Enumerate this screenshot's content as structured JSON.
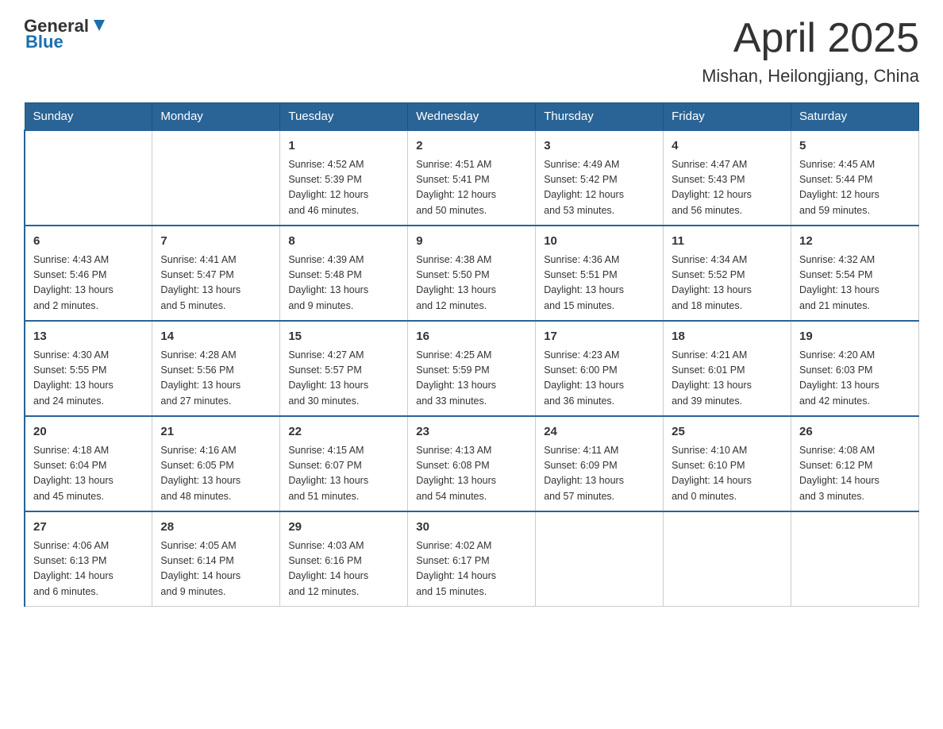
{
  "header": {
    "logo": {
      "general": "General",
      "blue": "Blue"
    },
    "title": "April 2025",
    "location": "Mishan, Heilongjiang, China"
  },
  "calendar": {
    "days_of_week": [
      "Sunday",
      "Monday",
      "Tuesday",
      "Wednesday",
      "Thursday",
      "Friday",
      "Saturday"
    ],
    "weeks": [
      [
        {
          "day": "",
          "info": ""
        },
        {
          "day": "",
          "info": ""
        },
        {
          "day": "1",
          "info": "Sunrise: 4:52 AM\nSunset: 5:39 PM\nDaylight: 12 hours\nand 46 minutes."
        },
        {
          "day": "2",
          "info": "Sunrise: 4:51 AM\nSunset: 5:41 PM\nDaylight: 12 hours\nand 50 minutes."
        },
        {
          "day": "3",
          "info": "Sunrise: 4:49 AM\nSunset: 5:42 PM\nDaylight: 12 hours\nand 53 minutes."
        },
        {
          "day": "4",
          "info": "Sunrise: 4:47 AM\nSunset: 5:43 PM\nDaylight: 12 hours\nand 56 minutes."
        },
        {
          "day": "5",
          "info": "Sunrise: 4:45 AM\nSunset: 5:44 PM\nDaylight: 12 hours\nand 59 minutes."
        }
      ],
      [
        {
          "day": "6",
          "info": "Sunrise: 4:43 AM\nSunset: 5:46 PM\nDaylight: 13 hours\nand 2 minutes."
        },
        {
          "day": "7",
          "info": "Sunrise: 4:41 AM\nSunset: 5:47 PM\nDaylight: 13 hours\nand 5 minutes."
        },
        {
          "day": "8",
          "info": "Sunrise: 4:39 AM\nSunset: 5:48 PM\nDaylight: 13 hours\nand 9 minutes."
        },
        {
          "day": "9",
          "info": "Sunrise: 4:38 AM\nSunset: 5:50 PM\nDaylight: 13 hours\nand 12 minutes."
        },
        {
          "day": "10",
          "info": "Sunrise: 4:36 AM\nSunset: 5:51 PM\nDaylight: 13 hours\nand 15 minutes."
        },
        {
          "day": "11",
          "info": "Sunrise: 4:34 AM\nSunset: 5:52 PM\nDaylight: 13 hours\nand 18 minutes."
        },
        {
          "day": "12",
          "info": "Sunrise: 4:32 AM\nSunset: 5:54 PM\nDaylight: 13 hours\nand 21 minutes."
        }
      ],
      [
        {
          "day": "13",
          "info": "Sunrise: 4:30 AM\nSunset: 5:55 PM\nDaylight: 13 hours\nand 24 minutes."
        },
        {
          "day": "14",
          "info": "Sunrise: 4:28 AM\nSunset: 5:56 PM\nDaylight: 13 hours\nand 27 minutes."
        },
        {
          "day": "15",
          "info": "Sunrise: 4:27 AM\nSunset: 5:57 PM\nDaylight: 13 hours\nand 30 minutes."
        },
        {
          "day": "16",
          "info": "Sunrise: 4:25 AM\nSunset: 5:59 PM\nDaylight: 13 hours\nand 33 minutes."
        },
        {
          "day": "17",
          "info": "Sunrise: 4:23 AM\nSunset: 6:00 PM\nDaylight: 13 hours\nand 36 minutes."
        },
        {
          "day": "18",
          "info": "Sunrise: 4:21 AM\nSunset: 6:01 PM\nDaylight: 13 hours\nand 39 minutes."
        },
        {
          "day": "19",
          "info": "Sunrise: 4:20 AM\nSunset: 6:03 PM\nDaylight: 13 hours\nand 42 minutes."
        }
      ],
      [
        {
          "day": "20",
          "info": "Sunrise: 4:18 AM\nSunset: 6:04 PM\nDaylight: 13 hours\nand 45 minutes."
        },
        {
          "day": "21",
          "info": "Sunrise: 4:16 AM\nSunset: 6:05 PM\nDaylight: 13 hours\nand 48 minutes."
        },
        {
          "day": "22",
          "info": "Sunrise: 4:15 AM\nSunset: 6:07 PM\nDaylight: 13 hours\nand 51 minutes."
        },
        {
          "day": "23",
          "info": "Sunrise: 4:13 AM\nSunset: 6:08 PM\nDaylight: 13 hours\nand 54 minutes."
        },
        {
          "day": "24",
          "info": "Sunrise: 4:11 AM\nSunset: 6:09 PM\nDaylight: 13 hours\nand 57 minutes."
        },
        {
          "day": "25",
          "info": "Sunrise: 4:10 AM\nSunset: 6:10 PM\nDaylight: 14 hours\nand 0 minutes."
        },
        {
          "day": "26",
          "info": "Sunrise: 4:08 AM\nSunset: 6:12 PM\nDaylight: 14 hours\nand 3 minutes."
        }
      ],
      [
        {
          "day": "27",
          "info": "Sunrise: 4:06 AM\nSunset: 6:13 PM\nDaylight: 14 hours\nand 6 minutes."
        },
        {
          "day": "28",
          "info": "Sunrise: 4:05 AM\nSunset: 6:14 PM\nDaylight: 14 hours\nand 9 minutes."
        },
        {
          "day": "29",
          "info": "Sunrise: 4:03 AM\nSunset: 6:16 PM\nDaylight: 14 hours\nand 12 minutes."
        },
        {
          "day": "30",
          "info": "Sunrise: 4:02 AM\nSunset: 6:17 PM\nDaylight: 14 hours\nand 15 minutes."
        },
        {
          "day": "",
          "info": ""
        },
        {
          "day": "",
          "info": ""
        },
        {
          "day": "",
          "info": ""
        }
      ]
    ]
  }
}
